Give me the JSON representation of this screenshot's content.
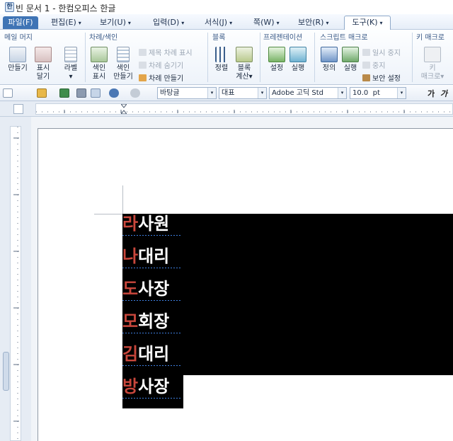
{
  "window": {
    "title": "빈 문서 1 - 한컴오피스 한글",
    "app_icon": "hwp-app-icon"
  },
  "menu": {
    "items": [
      {
        "label": "파일(F)",
        "has_drop": false
      },
      {
        "label": "편집(E)",
        "has_drop": true
      },
      {
        "label": "보기(U)",
        "has_drop": true
      },
      {
        "label": "입력(D)",
        "has_drop": true
      },
      {
        "label": "서식(J)",
        "has_drop": true
      },
      {
        "label": "쪽(W)",
        "has_drop": true
      },
      {
        "label": "보안(R)",
        "has_drop": true
      },
      {
        "label": "도구(K)",
        "has_drop": true
      }
    ],
    "active_tab": "도구(K)",
    "drop_glyph": "▾"
  },
  "ribbon": {
    "groups": {
      "mail_merge": {
        "title": "메일 머지",
        "buttons": [
          {
            "label1": "만들기",
            "label2": ""
          },
          {
            "label1": "표시",
            "label2": "달기"
          },
          {
            "label1": "라벨",
            "label2": "▾"
          }
        ]
      },
      "toc_index": {
        "title": "차례/색인",
        "buttons": [
          {
            "label1": "색인",
            "label2": "표시"
          },
          {
            "label1": "색인",
            "label2": "만들기"
          }
        ],
        "small": [
          {
            "label": "제목 차례 표시",
            "disabled": true
          },
          {
            "label": "차례 숨기기",
            "disabled": true
          },
          {
            "label": "차례 만들기",
            "disabled": false
          }
        ]
      },
      "block": {
        "title": "블록",
        "buttons": [
          {
            "label1": "정렬",
            "label2": ""
          },
          {
            "label1": "블록",
            "label2": "계산▾"
          }
        ]
      },
      "presentation": {
        "title": "프레젠테이션",
        "buttons": [
          {
            "label1": "설정",
            "label2": ""
          },
          {
            "label1": "실행",
            "label2": ""
          }
        ]
      },
      "script_macro": {
        "title": "스크립트 매크로",
        "buttons": [
          {
            "label1": "정의",
            "label2": ""
          },
          {
            "label1": "실행",
            "label2": ""
          }
        ],
        "small": [
          {
            "label": "일시 중지",
            "disabled": true
          },
          {
            "label": "중지",
            "disabled": true
          },
          {
            "label": "보안 설정",
            "disabled": false
          }
        ]
      },
      "key_macro": {
        "title": "키 매크로",
        "buttons": [
          {
            "label1": "키",
            "label2": "매크로▾"
          }
        ]
      }
    }
  },
  "toolbar": {
    "style_combo": "바탕글",
    "representative_combo": "대표",
    "font_combo": "Adobe 고딕 Std",
    "size_combo": "10.0",
    "size_unit": "pt",
    "bold_label": "가",
    "italic_label": "가"
  },
  "document": {
    "lines": [
      {
        "surname": "라",
        "title": "사원"
      },
      {
        "surname": "나",
        "title": "대리"
      },
      {
        "surname": "도",
        "title": "사장"
      },
      {
        "surname": "모",
        "title": "회장"
      },
      {
        "surname": "김",
        "title": "대리"
      },
      {
        "surname": "방",
        "title": "사장"
      }
    ]
  },
  "colors": {
    "surname_text": "#c9473c",
    "title_text": "#ffffff",
    "block_background": "#000000",
    "active_menu_bg": "#3f74b5"
  }
}
